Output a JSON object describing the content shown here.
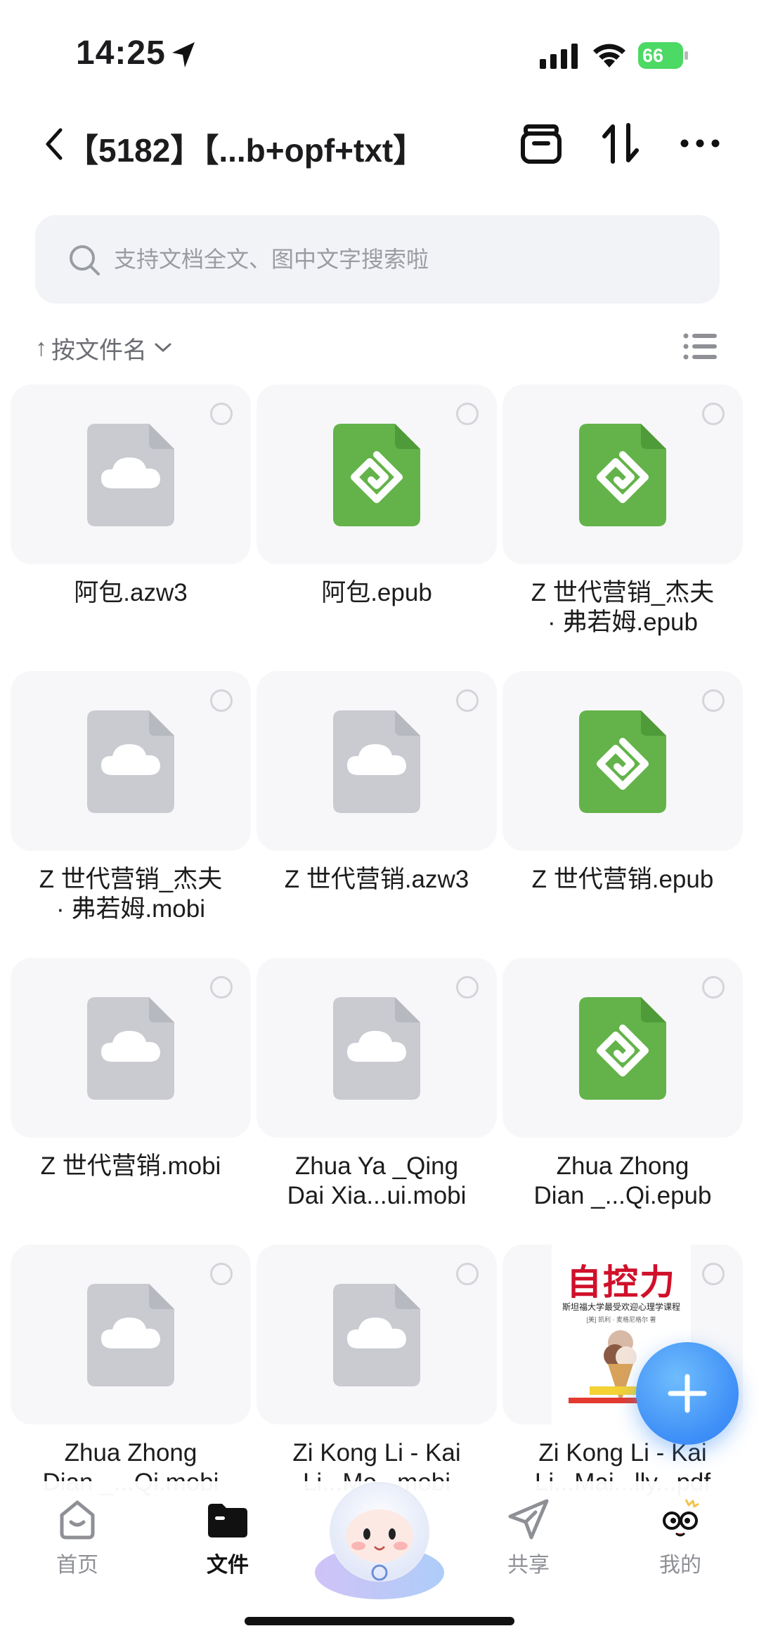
{
  "status_bar": {
    "time": "14:25",
    "battery": "66"
  },
  "nav": {
    "title": "【5182】【...b+opf+txt】"
  },
  "search": {
    "placeholder": "支持文档全文、图中文字搜索啦"
  },
  "sort": {
    "arrow": "↑",
    "label": "按文件名"
  },
  "files": [
    {
      "name": "阿包.azw3",
      "icon": "cloud-file-icon"
    },
    {
      "name": "阿包.epub",
      "icon": "epub-icon"
    },
    {
      "name": "Z 世代营销_杰夫\n· 弗若姆.epub",
      "icon": "epub-icon"
    },
    {
      "name": "Z 世代营销_杰夫\n· 弗若姆.mobi",
      "icon": "cloud-file-icon"
    },
    {
      "name": "Z 世代营销.azw3",
      "icon": "cloud-file-icon"
    },
    {
      "name": "Z 世代营销.epub",
      "icon": "epub-icon"
    },
    {
      "name": "Z 世代营销.mobi",
      "icon": "cloud-file-icon"
    },
    {
      "name": "Zhua Ya _Qing\nDai Xia...ui.mobi",
      "icon": "cloud-file-icon"
    },
    {
      "name": "Zhua Zhong\nDian _...Qi.epub",
      "icon": "epub-icon"
    },
    {
      "name": "Zhua Zhong\nDian _...Qi.mobi",
      "icon": "cloud-file-icon"
    },
    {
      "name": "Zi Kong Li - Kai\nLi...Mo...mobi",
      "icon": "cloud-file-icon"
    },
    {
      "name": "Zi Kong Li - Kai\nLi...Mai...lly...pdf",
      "icon": "book-cover"
    }
  ],
  "book_cover": {
    "title": "自控力",
    "subtitle": "斯坦福大学最受欢迎心理学课程",
    "author": "[美] 凯利 · 麦格尼格尔 著"
  },
  "tabs": [
    {
      "label": "首页",
      "icon": "home-icon",
      "active": false
    },
    {
      "label": "文件",
      "icon": "folder-icon",
      "active": true
    },
    {
      "label": "共享",
      "icon": "send-icon",
      "active": false
    },
    {
      "label": "我的",
      "icon": "profile-mascot-icon",
      "active": false
    }
  ],
  "colors": {
    "epub_green": "#63b34a",
    "cloud_gray": "#c9cbd1",
    "accent_blue": "#3d8ef7",
    "battery_green": "#4cd964"
  }
}
